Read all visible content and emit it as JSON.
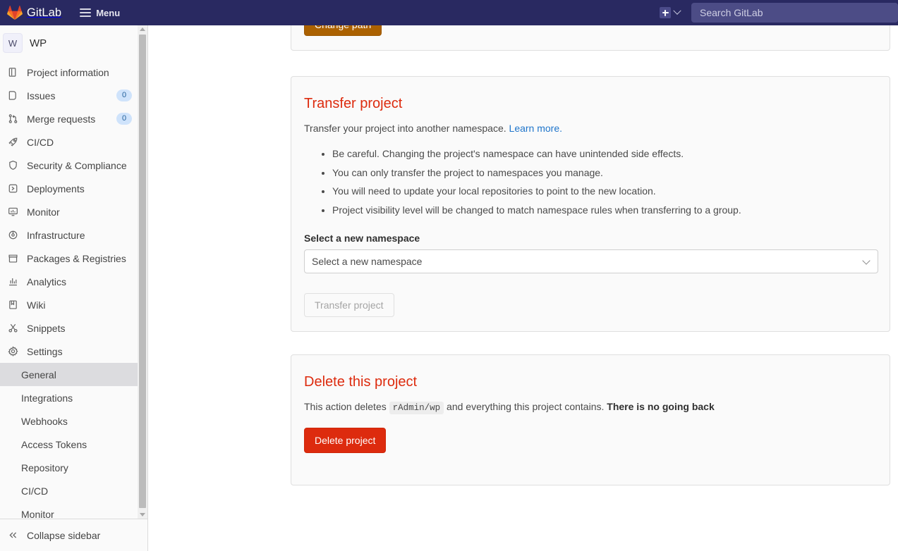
{
  "topbar": {
    "brand": "GitLab",
    "menu_label": "Menu",
    "new_icon": "plus-square-icon",
    "new_dropdown_icon": "chevron-down-icon",
    "search_placeholder": "Search GitLab",
    "search_value": "",
    "background_color": "#292961"
  },
  "sidebar": {
    "project": {
      "avatar_letter": "W",
      "name": "WP"
    },
    "items": [
      {
        "label": "Project information",
        "icon": "project-information-icon",
        "badge": null
      },
      {
        "label": "Issues",
        "icon": "issues-icon",
        "badge": "0"
      },
      {
        "label": "Merge requests",
        "icon": "merge-requests-icon",
        "badge": "0"
      },
      {
        "label": "CI/CD",
        "icon": "rocket-icon",
        "badge": null
      },
      {
        "label": "Security & Compliance",
        "icon": "shield-icon",
        "badge": null
      },
      {
        "label": "Deployments",
        "icon": "deployments-icon",
        "badge": null
      },
      {
        "label": "Monitor",
        "icon": "monitor-icon",
        "badge": null
      },
      {
        "label": "Infrastructure",
        "icon": "infrastructure-icon",
        "badge": null
      },
      {
        "label": "Packages & Registries",
        "icon": "package-icon",
        "badge": null
      },
      {
        "label": "Analytics",
        "icon": "analytics-icon",
        "badge": null
      },
      {
        "label": "Wiki",
        "icon": "book-icon",
        "badge": null
      },
      {
        "label": "Snippets",
        "icon": "snippet-icon",
        "badge": null
      },
      {
        "label": "Settings",
        "icon": "gear-icon",
        "badge": null
      }
    ],
    "settings_subitems": [
      {
        "label": "General",
        "active": true
      },
      {
        "label": "Integrations",
        "active": false
      },
      {
        "label": "Webhooks",
        "active": false
      },
      {
        "label": "Access Tokens",
        "active": false
      },
      {
        "label": "Repository",
        "active": false
      },
      {
        "label": "CI/CD",
        "active": false
      },
      {
        "label": "Monitor",
        "active": false
      }
    ],
    "collapse_label": "Collapse sidebar",
    "collapse_icon": "chevron-double-left-icon"
  },
  "main": {
    "change_path": {
      "button_label": "Change path"
    },
    "transfer": {
      "title": "Transfer project",
      "description_text": "Transfer your project into another namespace.",
      "description_link": "Learn more.",
      "warnings": [
        "Be careful. Changing the project's namespace can have unintended side effects.",
        "You can only transfer the project to namespaces you manage.",
        "You will need to update your local repositories to point to the new location.",
        "Project visibility level will be changed to match namespace rules when transferring to a group."
      ],
      "field_label": "Select a new namespace",
      "select_value": "Select a new namespace",
      "select_icon": "chevron-down-icon",
      "button_label": "Transfer project",
      "button_disabled": true
    },
    "delete": {
      "title": "Delete this project",
      "description_prefix": "This action deletes",
      "project_path": "rAdmin/wp",
      "description_middle": "and everything this project contains.",
      "description_strong": "There is no going back",
      "button_label": "Delete project",
      "button_color": "#dd2b0e"
    }
  }
}
